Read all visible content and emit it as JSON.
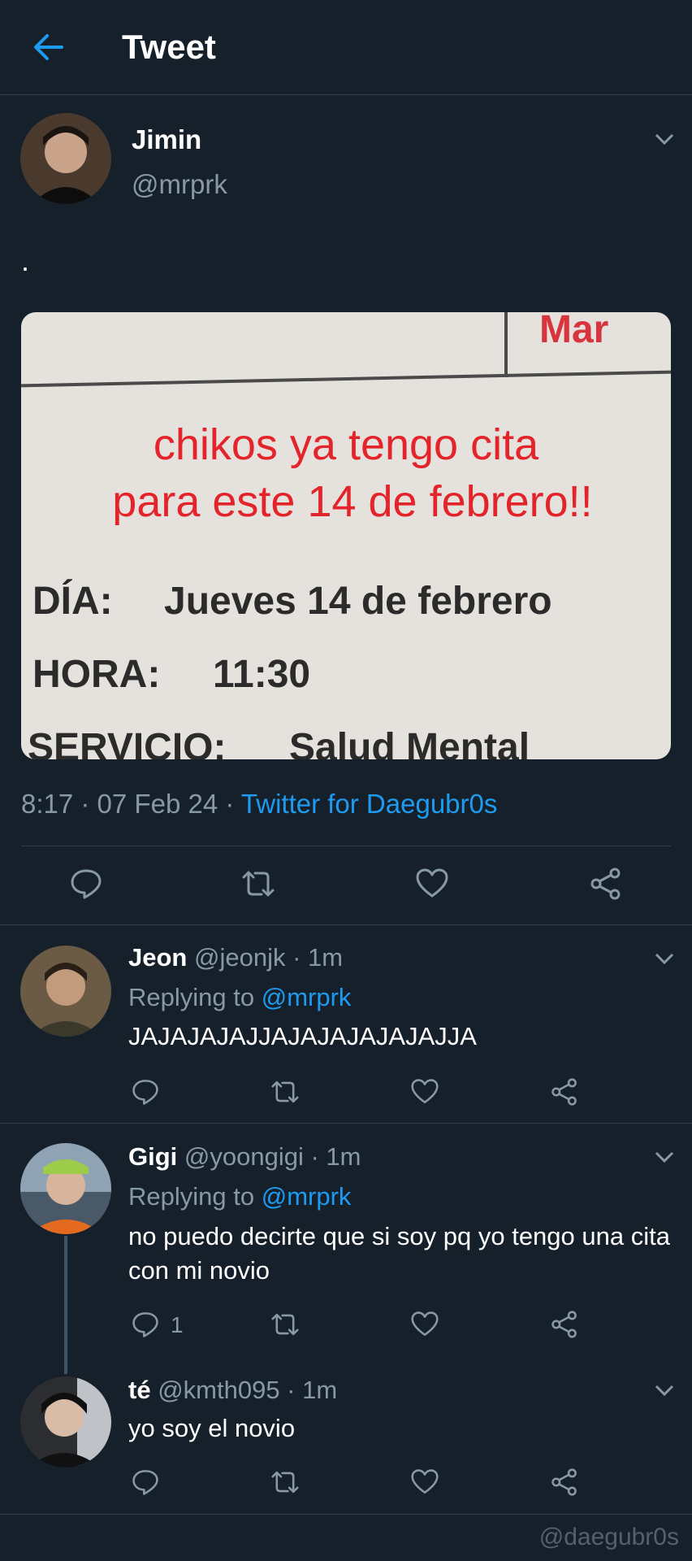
{
  "header": {
    "title": "Tweet"
  },
  "tweet": {
    "name": "Jimin",
    "handle": "@mrprk",
    "text": ".",
    "image_text": {
      "corner": "Mar",
      "line1": "chikos ya tengo cita",
      "line2": "para este 14 de febrero!!",
      "dia_label": "DÍA:",
      "dia_value": "Jueves 14 de febrero",
      "hora_label": "HORA:",
      "hora_value": "11:30",
      "servicio_label": "SERVICIO:",
      "servicio_value": "Salud Mental"
    },
    "meta_time": "8:17 · 07 Feb 24 · ",
    "meta_source": "Twitter for Daegubr0s"
  },
  "replies": [
    {
      "name": "Jeon",
      "handle_time": "@jeonjk · 1m",
      "replying_prefix": "Replying to ",
      "replying_mention": "@mrprk",
      "text": "JAJAJAJAJJAJAJAJAJAJAJJA",
      "reply_count": ""
    },
    {
      "name": "Gigi",
      "handle_time": "@yoongigi · 1m",
      "replying_prefix": "Replying to ",
      "replying_mention": "@mrprk",
      "text": "no puedo decirte que si soy pq yo tengo una cita con mi novio",
      "reply_count": "1"
    },
    {
      "name": "té",
      "handle_time": "@kmth095 · 1m",
      "text": "yo soy el novio",
      "reply_count": ""
    }
  ],
  "watermark": "@daegubr0s",
  "icons": [
    "back-arrow-icon",
    "chevron-down-icon",
    "reply-icon",
    "retweet-icon",
    "like-icon",
    "share-icon"
  ],
  "colors": {
    "background": "#15202b",
    "accent": "#1d9bf0",
    "muted": "#8899a6",
    "divider": "#2f3b47"
  }
}
